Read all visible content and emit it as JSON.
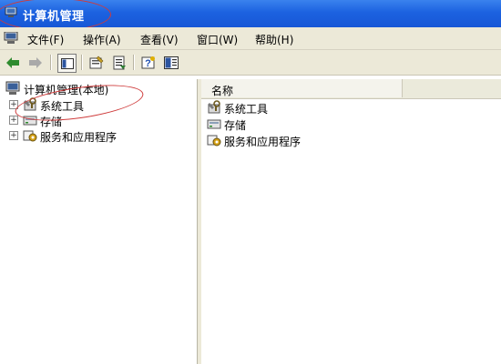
{
  "window": {
    "title": "计算机管理"
  },
  "menu": {
    "items": [
      {
        "label": "文件(F)"
      },
      {
        "label": "操作(A)"
      },
      {
        "label": "查看(V)"
      },
      {
        "label": "窗口(W)"
      },
      {
        "label": "帮助(H)"
      }
    ]
  },
  "tree": {
    "root": "计算机管理(本地)",
    "items": [
      {
        "label": "系统工具",
        "icon": "tools-icon"
      },
      {
        "label": "存储",
        "icon": "storage-icon"
      },
      {
        "label": "服务和应用程序",
        "icon": "services-icon"
      }
    ]
  },
  "list": {
    "column_name": "名称",
    "rows": [
      {
        "label": "系统工具",
        "icon": "tools-icon"
      },
      {
        "label": "存储",
        "icon": "storage-icon"
      },
      {
        "label": "服务和应用程序",
        "icon": "services-icon"
      }
    ]
  },
  "colors": {
    "titlebar": "#1c62e0",
    "chrome": "#ece9d8",
    "annotation": "#cf3b3b"
  }
}
